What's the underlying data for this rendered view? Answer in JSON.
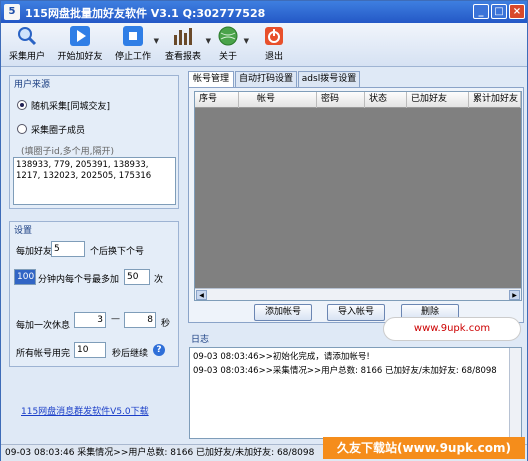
{
  "window": {
    "title": "115网盘批量加好友软件 V3.1 Q:302777528",
    "controls": [
      "_",
      "□",
      "×"
    ]
  },
  "toolbar": {
    "items": [
      {
        "label": "采集用户",
        "icon": "magnifier-icon"
      },
      {
        "label": "开始加好友",
        "icon": "play-icon"
      },
      {
        "label": "停止工作",
        "icon": "stop-icon"
      },
      {
        "label": "查看报表",
        "icon": "report-icon"
      },
      {
        "label": "关于",
        "icon": "globe-icon"
      },
      {
        "label": "退出",
        "icon": "power-icon"
      }
    ]
  },
  "user_source": {
    "title": "用户来源",
    "option_random": "随机采集[同城交友]",
    "option_circle": "采集圈子成员",
    "hint": "(填圈子id,多个用,隔开)",
    "ids_value": "138933, 779, 205391, 138933, 1217, 132023, 202505, 175316"
  },
  "settings": {
    "title": "设置",
    "every_add_label": "每加好友",
    "every_add_value": "5",
    "every_add_suffix": "个后换下个号",
    "minutes_value": "100",
    "minutes_label": "分钟内每个号最多加",
    "max_add_value": "50",
    "max_add_suffix": "次",
    "rest_label": "每加一次休息",
    "rest_min": "3",
    "rest_dash": "—",
    "rest_max": "8",
    "rest_unit": "秒",
    "resume_label": "所有帐号用完",
    "resume_value": "10",
    "resume_suffix": "秒后继续"
  },
  "promo_link": "115网盘消息群发软件V5.0下载",
  "tabs": [
    "帐号管理",
    "自动打码设置",
    "adsl拨号设置"
  ],
  "grid": {
    "columns": [
      "序号",
      "帐号",
      "密码",
      "状态",
      "已加好友",
      "累计加好友"
    ]
  },
  "buttons": {
    "add_account": "添加帐号",
    "import_account": "导入帐号",
    "delete": "删除"
  },
  "log": {
    "title": "日志",
    "lines": [
      "09-03 08:03:46>>初始化完成，请添加帐号!",
      "09-03 08:03:46>>采集情况>>用户总数: 8166 已加好友/未加好友: 68/8098"
    ]
  },
  "status_bar": "09-03 08:03:46 采集情况>>用户总数: 8166 已加好友/未加好友: 68/8098",
  "overlay": {
    "bubble": "www.9upk.com",
    "watermark": "久友下载站(www.9upk.com)"
  }
}
